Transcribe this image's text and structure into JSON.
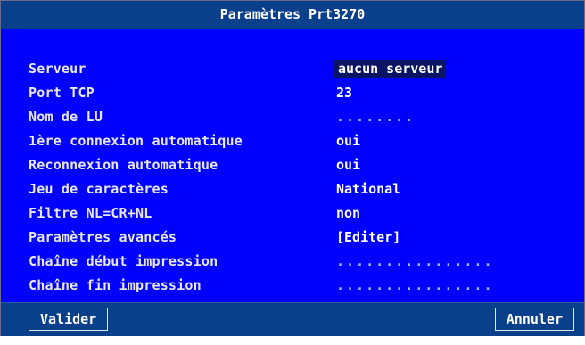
{
  "window": {
    "title": "Paramètres Prt3270"
  },
  "fields": [
    {
      "label": "Serveur",
      "value": "aucun serveur"
    },
    {
      "label": "Port TCP",
      "value": "23"
    },
    {
      "label": "Nom de LU",
      "value": "........"
    },
    {
      "label": "1ère connexion automatique",
      "value": "oui"
    },
    {
      "label": "Reconnexion automatique",
      "value": "oui"
    },
    {
      "label": "Jeu de caractères",
      "value": "National"
    },
    {
      "label": "Filtre NL=CR+NL",
      "value": "non"
    },
    {
      "label": "Paramètres avancés",
      "value": "[Editer]"
    },
    {
      "label": "Chaîne début impression",
      "value": "................"
    },
    {
      "label": "Chaîne fin impression",
      "value": "................"
    }
  ],
  "buttons": {
    "validate": "Valider",
    "cancel": "Annuler"
  },
  "colors": {
    "background": "#0000ff",
    "title_bar": "#0a3f8c",
    "selected_value_bg": "#0b1464",
    "text": "#ffffff"
  }
}
